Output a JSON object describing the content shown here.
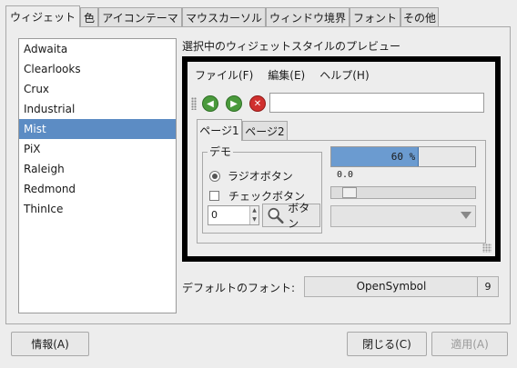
{
  "tabs": [
    {
      "label": "ウィジェット",
      "active": true
    },
    {
      "label": "色"
    },
    {
      "label": "アイコンテーマ"
    },
    {
      "label": "マウスカーソル"
    },
    {
      "label": "ウィンドウ境界"
    },
    {
      "label": "フォント"
    },
    {
      "label": "その他"
    }
  ],
  "themes": [
    "Adwaita",
    "Clearlooks",
    "Crux",
    "Industrial",
    "Mist",
    "PiX",
    "Raleigh",
    "Redmond",
    "ThinIce"
  ],
  "selected_theme": "Mist",
  "preview": {
    "label": "選択中のウィジェットスタイルのプレビュー",
    "menu": [
      "ファイル(F)",
      "編集(E)",
      "ヘルプ(H)"
    ],
    "toolbar_icons": [
      "back-icon",
      "forward-icon",
      "stop-icon"
    ],
    "tabs": [
      "ページ1",
      "ページ2"
    ],
    "demo_label": "デモ",
    "radio_label": "ラジオボタン",
    "check_label": "チェックボタン",
    "spin_value": "0",
    "button_label": "ボタン",
    "progress_text": "60 %",
    "progress_fraction": 0.6,
    "scale_value": "0.0",
    "scale_fraction": 0.0
  },
  "font": {
    "label": "デフォルトのフォント:",
    "name": "OpenSymbol",
    "size": "9"
  },
  "buttons": {
    "about": "情報(A)",
    "close": "閉じる(C)",
    "apply": "適用(A)"
  }
}
